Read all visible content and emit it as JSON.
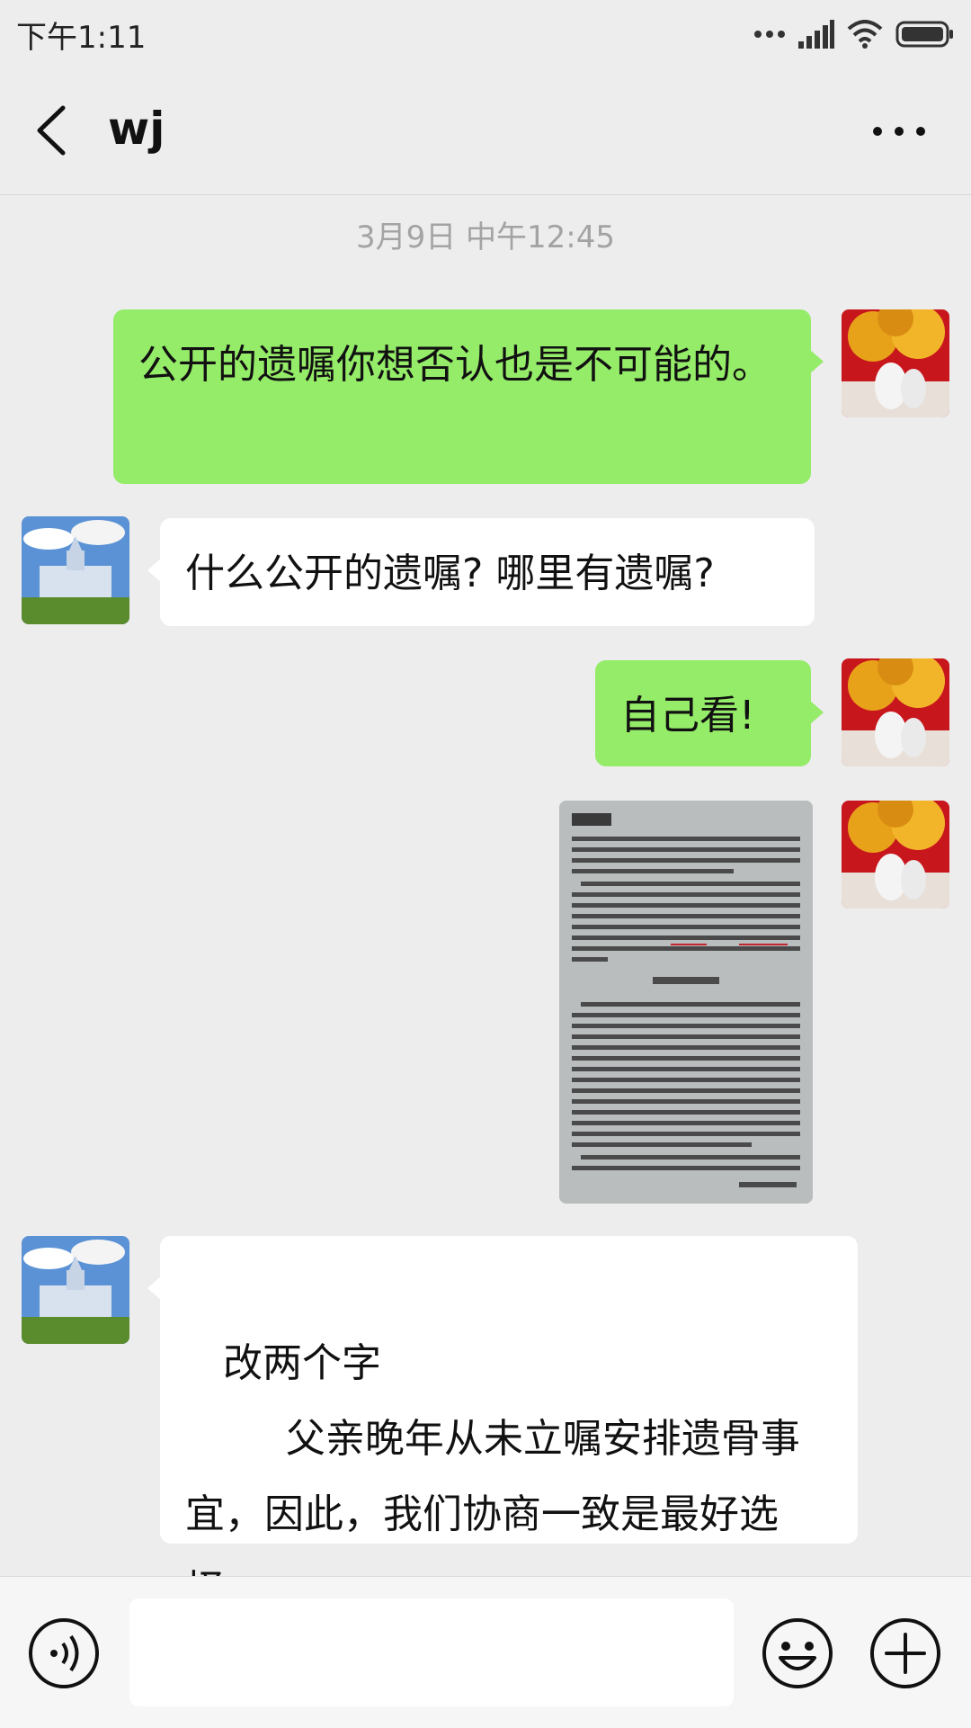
{
  "status_bar": {
    "time": "下午1:11",
    "icons": [
      "more-dots-icon",
      "signal-icon",
      "wifi-icon",
      "battery-icon"
    ]
  },
  "header": {
    "title": "wj",
    "back_icon": "chevron-left-icon",
    "more_icon": "more-horizontal-icon"
  },
  "chat": {
    "timestamp": "3月9日 中午12:45",
    "messages": [
      {
        "side": "me",
        "type": "text",
        "text": "公开的遗嘱你想否认也是不可能的。"
      },
      {
        "side": "them",
        "type": "text",
        "text": "什么公开的遗嘱? 哪里有遗嘱?"
      },
      {
        "side": "me",
        "type": "text",
        "text": "自己看!"
      },
      {
        "side": "me",
        "type": "image",
        "description": "photo of a book page"
      },
      {
        "side": "them",
        "type": "text",
        "text": " 改两个字\n        父亲晚年从未立嘱安排遗骨事宜，因此，我们协商一致是最好选择。"
      }
    ]
  },
  "input_bar": {
    "input_value": "",
    "icons": [
      "voice-icon",
      "emoji-icon",
      "plus-icon"
    ]
  },
  "colors": {
    "background": "#ededed",
    "my_bubble": "#95ec69",
    "their_bubble": "#ffffff",
    "timestamp": "#a3a3a3"
  }
}
